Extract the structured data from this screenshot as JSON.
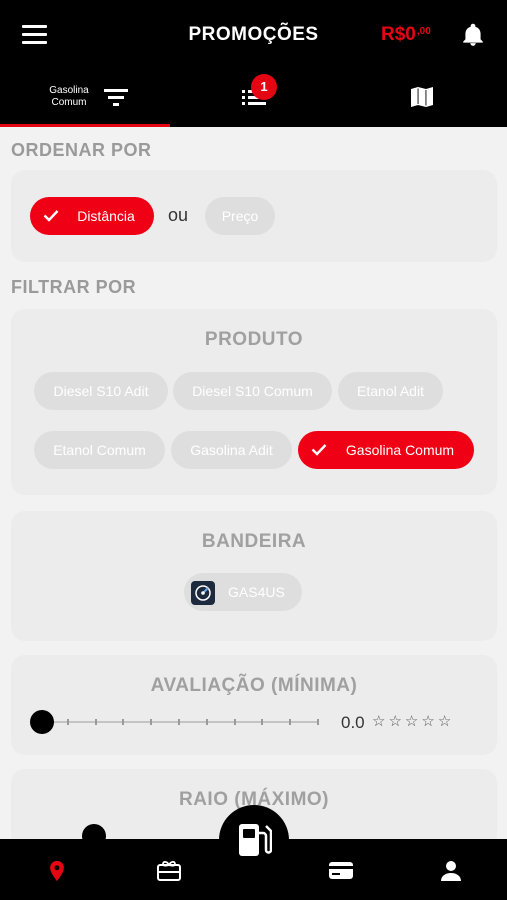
{
  "header": {
    "title": "PROMOÇÕES",
    "balance_main": "R$0",
    "balance_cents": ",00",
    "icons": [
      "hamburger-menu-icon",
      "bell-icon"
    ]
  },
  "tabs": {
    "fuel_label": "Gasolina Comum",
    "list_badge": "1",
    "icons": [
      "filter-icon",
      "list-icon",
      "map-icon"
    ]
  },
  "order": {
    "title": "ORDENAR POR",
    "options": [
      "Distância",
      "Preço"
    ],
    "selected": "Distância",
    "separator": "ou"
  },
  "filter": {
    "title": "FILTRAR POR",
    "product": {
      "title": "PRODUTO",
      "options": [
        "Diesel S10 Adit",
        "Diesel S10 Comum",
        "Etanol Adit",
        "Etanol Comum",
        "Gasolina Adit",
        "Gasolina Comum"
      ],
      "selected": "Gasolina Comum"
    },
    "flag": {
      "title": "BANDEIRA",
      "option": "GAS4US"
    },
    "rating": {
      "title": "AVALIAÇÃO (MÍNIMA)",
      "value_text": "0.0",
      "value": 0,
      "max": 5
    },
    "radius": {
      "title": "RAIO (MÁXIMO)"
    }
  },
  "bottom_nav": {
    "items": [
      "location-pin-icon",
      "gift-card-icon",
      "fuel-pump-icon",
      "wallet-card-icon",
      "user-icon"
    ],
    "active": "location-pin-icon"
  },
  "colors": {
    "accent": "#e40613",
    "chip_selected": "#f00014",
    "chip_unselected": "#dedede",
    "card_bg": "#ececec",
    "bar_bg": "#000000"
  }
}
